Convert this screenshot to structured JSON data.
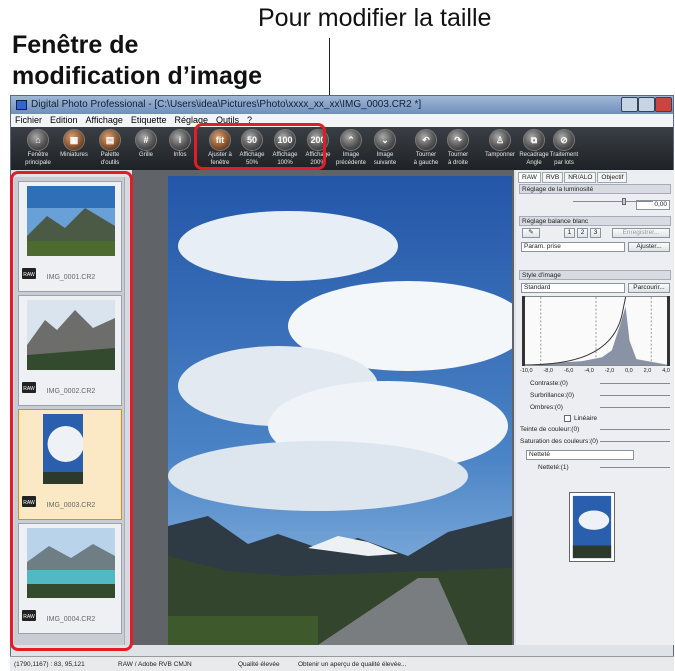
{
  "captions": {
    "resize": "Pour modifier la taille",
    "window_line1": "Fenêtre de",
    "window_line2": "modification d’image"
  },
  "window": {
    "title": "Digital Photo Professional - [C:\\Users\\idea\\Pictures\\Photo\\xxxx_xx_xx\\IMG_0003.CR2 *]"
  },
  "menu": [
    "Fichier",
    "Edition",
    "Affichage",
    "Etiquette",
    "Réglage",
    "Outils",
    "?"
  ],
  "toolbar": [
    {
      "icon": "home-icon",
      "label1": "Fenêtre",
      "label2": "principale"
    },
    {
      "icon": "thumbnails-icon",
      "label1": "Miniatures",
      "label2": ""
    },
    {
      "icon": "tool-palette-icon",
      "label1": "Palette",
      "label2": "d'outils"
    },
    {
      "icon": "grid-icon",
      "label1": "Grille",
      "label2": ""
    },
    {
      "icon": "info-icon",
      "glyph": "i",
      "label1": "Infos",
      "label2": ""
    },
    {
      "icon": "fit-window-icon",
      "glyph": "fit",
      "label1": "Ajuster à",
      "label2": "fenêtre"
    },
    {
      "icon": "zoom-50-icon",
      "glyph": "50",
      "label1": "Affichage",
      "label2": "50%"
    },
    {
      "icon": "zoom-100-icon",
      "glyph": "100",
      "label1": "Affichage",
      "label2": "100%"
    },
    {
      "icon": "zoom-200-icon",
      "glyph": "200",
      "label1": "Affichage",
      "label2": "200%"
    },
    {
      "icon": "previous-image-icon",
      "glyph": "⌃",
      "label1": "Image",
      "label2": "précédente"
    },
    {
      "icon": "next-image-icon",
      "glyph": "⌄",
      "label1": "Image",
      "label2": "suivante"
    },
    {
      "icon": "rotate-left-icon",
      "glyph": "↶",
      "label1": "Tourner",
      "label2": "à gauche"
    },
    {
      "icon": "rotate-right-icon",
      "glyph": "↷",
      "label1": "Tourner",
      "label2": "à droite"
    },
    {
      "icon": "stamp-icon",
      "label1": "Tamponner",
      "label2": ""
    },
    {
      "icon": "crop-angle-icon",
      "label1": "Recadrage",
      "label2": "Angle"
    },
    {
      "icon": "batch-process-icon",
      "label1": "Traitement",
      "label2": "par lots"
    }
  ],
  "thumbnails": [
    "IMG_0001.CR2",
    "IMG_0002.CR2",
    "IMG_0003.CR2",
    "IMG_0004.CR2"
  ],
  "raw_badge": "RAW",
  "panel": {
    "tabs": [
      "RAW",
      "RVB",
      "NR/ALO",
      "Objectif"
    ],
    "brightness": {
      "title": "Réglage de la luminosité",
      "value": "0,00"
    },
    "wb": {
      "title": "Réglage balance blanc",
      "b1": "1",
      "b2": "2",
      "b3": "3",
      "register": "Enregistrer...",
      "mode": "Param. prise",
      "adjust": "Ajuster..."
    },
    "style": {
      "title": "Style d'image",
      "value": "Standard",
      "browse": "Parcourir..."
    },
    "axis": [
      "-10,0",
      "-8,0",
      "-6,0",
      "-4,0",
      "-2,0",
      "0,0",
      "2,0",
      "4,0"
    ],
    "contrast": "Contraste:(0)",
    "highlight": "Surbrillance:(0)",
    "shadows": "Ombres:(0)",
    "linear": "Linéaire",
    "tone": "Teinte de couleur:(0)",
    "saturation": "Saturation des couleurs:(0)",
    "sharp_mode": "Netteté",
    "sharp": "Netteté:(1)"
  },
  "status": {
    "coords": "(1790,1167) : 83, 95,121",
    "profile": "RAW / Adobe RVB CMJN",
    "quality": "Qualité élevée",
    "message": "Obtenir un aperçu de qualité élevée..."
  },
  "colors": {
    "annotation": "#e21d25"
  }
}
